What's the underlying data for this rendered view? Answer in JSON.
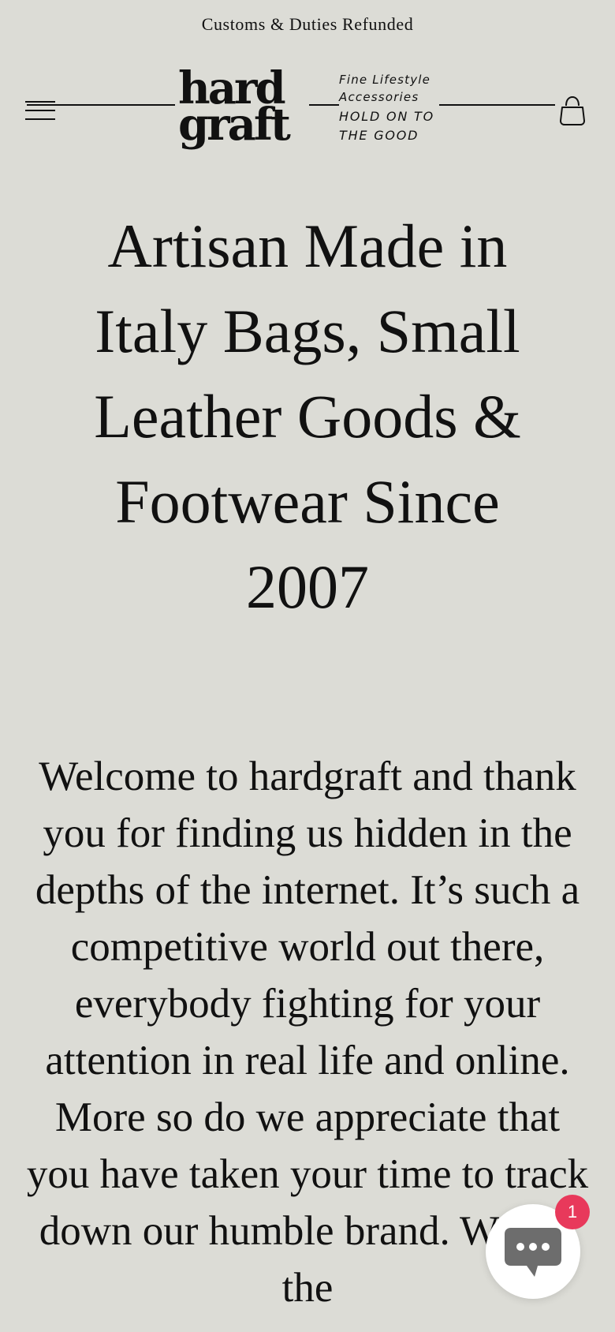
{
  "announcement": {
    "text": "Customs & Duties Refunded"
  },
  "header": {
    "logo": {
      "line1": "hard",
      "line2": "graft"
    },
    "tagline": {
      "line1": "Fine Lifestyle",
      "line2": "Accessories",
      "line3": "HOLD ON TO",
      "line4": "THE GOOD"
    },
    "menu_icon": "hamburger-menu-icon",
    "cart_icon": "shopping-bag-icon"
  },
  "hero": {
    "title": "Artisan Made in Italy Bags, Small Leather Goods & Footwear Since 2007"
  },
  "intro": {
    "text": "Welcome to hardgraft and thank you for finding us hidden in the depths of the internet. It’s such a competitive world out there, everybody fighting for your attention in real life and online. More so do we appreciate that you have taken your time to track down our humble brand. We are the"
  },
  "chat": {
    "icon": "chat-bubble-icon",
    "badge_count": "1",
    "badge_color": "#e8395b"
  },
  "colors": {
    "background": "#dcdcd6",
    "text": "#111111"
  }
}
